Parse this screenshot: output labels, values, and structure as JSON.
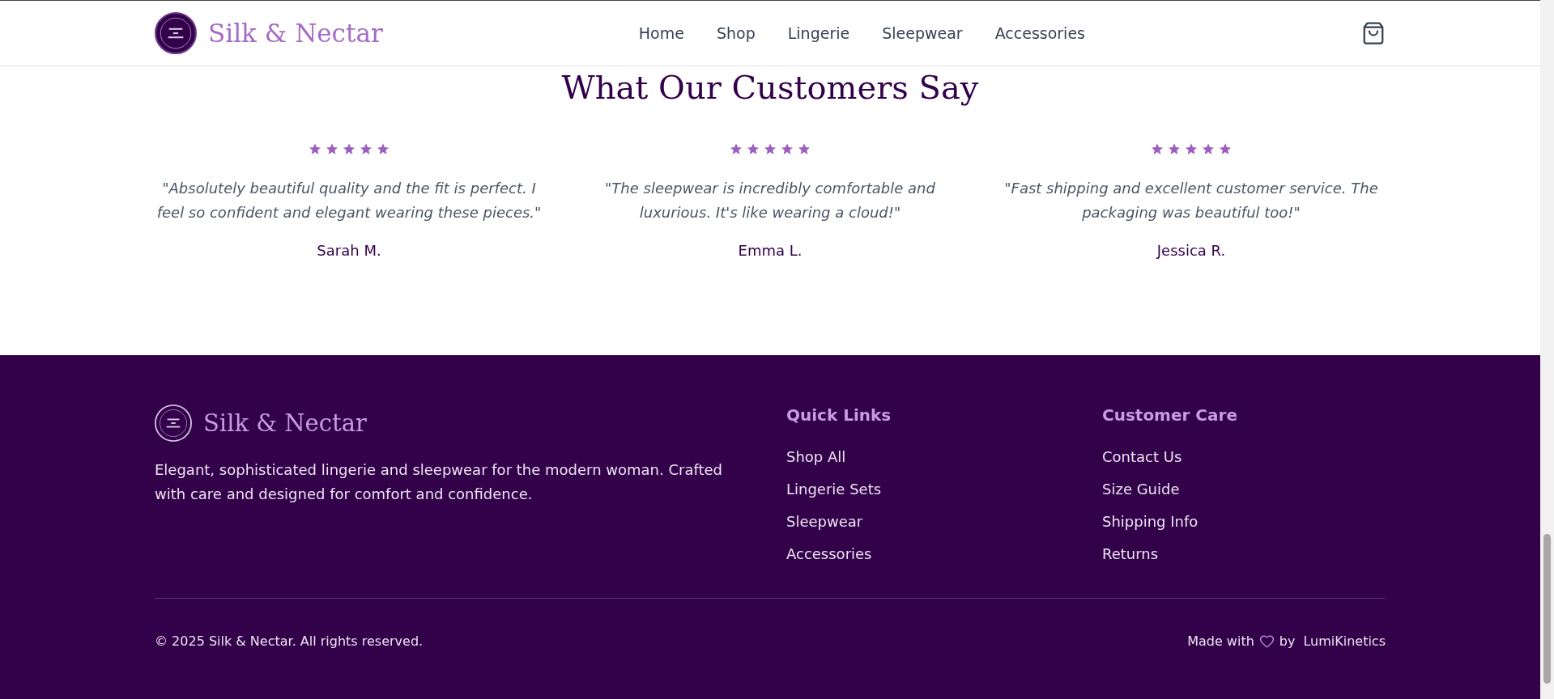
{
  "header": {
    "brand": "Silk & Nectar",
    "nav": [
      "Home",
      "Shop",
      "Lingerie",
      "Sleepwear",
      "Accessories"
    ]
  },
  "testimonials": {
    "title": "What Our Customers Say",
    "items": [
      {
        "stars": 5,
        "quote": "\"Absolutely beautiful quality and the fit is perfect. I feel so confident and elegant wearing these pieces.\"",
        "name": "Sarah M."
      },
      {
        "stars": 5,
        "quote": "\"The sleepwear is incredibly comfortable and luxurious. It's like wearing a cloud!\"",
        "name": "Emma L."
      },
      {
        "stars": 5,
        "quote": "\"Fast shipping and excellent customer service. The packaging was beautiful too!\"",
        "name": "Jessica R."
      }
    ]
  },
  "footer": {
    "brand": "Silk & Nectar",
    "description": "Elegant, sophisticated lingerie and sleepwear for the modern woman. Crafted with care and designed for comfort and confidence.",
    "columns": [
      {
        "title": "Quick Links",
        "links": [
          "Shop All",
          "Lingerie Sets",
          "Sleepwear",
          "Accessories"
        ]
      },
      {
        "title": "Customer Care",
        "links": [
          "Contact Us",
          "Size Guide",
          "Shipping Info",
          "Returns"
        ]
      }
    ],
    "copyright": "© 2025 Silk & Nectar. All rights reserved.",
    "made_with": "Made with",
    "by": "by",
    "credit": "LumiKinetics"
  }
}
